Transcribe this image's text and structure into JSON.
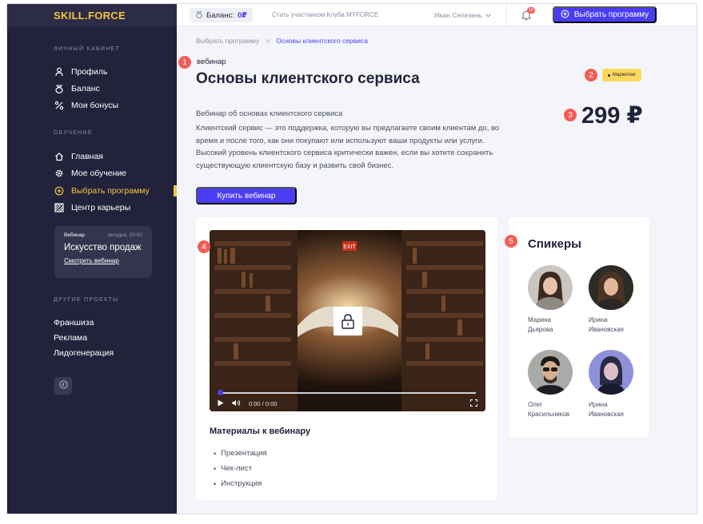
{
  "app": {
    "logo": "SKILL.FORCE"
  },
  "header": {
    "balance_label": "Баланс:",
    "balance_value": "0₽",
    "club_link": "Стать участником Клуба MYFORCE",
    "user_name": "Иван Селезень",
    "notifications_count": "10",
    "choose_program": "Выбрать программу"
  },
  "sidebar": {
    "section_personal": "ЛИЧНЫЙ КАБИНЕТ",
    "personal_items": [
      {
        "label": "Профиль",
        "icon": "profile-icon"
      },
      {
        "label": "Баланс",
        "icon": "wallet-icon"
      },
      {
        "label": "Мои бонусы",
        "icon": "percent-icon"
      }
    ],
    "section_learning": "ОБУЧЕНИЕ",
    "learning_items": [
      {
        "label": "Главная",
        "icon": "home-icon"
      },
      {
        "label": "Мое обучение",
        "icon": "gear-icon"
      },
      {
        "label": "Выбрать программу",
        "icon": "plus-circle-icon",
        "active": true
      },
      {
        "label": "Центр карьеры",
        "icon": "grid-icon"
      }
    ],
    "webinar_card": {
      "badge": "Вебинар",
      "date": "сегодня, 20:00",
      "title": "Искусство продаж",
      "link": "Смотреть вебинар"
    },
    "section_other": "ДРУГИЕ ПРОЕКТЫ",
    "other_items": [
      "Франшиза",
      "Реклама",
      "Лидогенерация"
    ]
  },
  "breadcrumb": {
    "items": [
      "Выбрать программу",
      "Основы клиентского сервиса"
    ],
    "separator": ">"
  },
  "product": {
    "type": "вебинар",
    "title": "Основы клиентского сервиса",
    "tag": "Маркетинг",
    "price": "299 ₽",
    "desc_title": "Вебинар об основах клиентского сервиса",
    "description": "Клиентский сервис — это поддержка, которую вы предлагаете своим клиентам до, во время и после того, как они покупают или используют ваши продукты или услуги. Высокий уровень клиентского сервиса критически важен, если вы хотите сохранить существующую клиентскую базу и развить свой бизнес.",
    "buy_button": "Купить вебинар"
  },
  "video": {
    "time": "0:00 / 0:00",
    "progress": 0
  },
  "materials": {
    "title": "Материалы к вебинару",
    "items": [
      "Презентация",
      "Чек-лист",
      "Инструкция"
    ]
  },
  "speakers": {
    "title": "Спикеры",
    "items": [
      {
        "first": "Марина",
        "last": "Дьярова"
      },
      {
        "first": "Ирина",
        "last": "Ивановская"
      },
      {
        "first": "Олег",
        "last": "Красильников"
      },
      {
        "first": "Ирина",
        "last": "Ивановская"
      }
    ]
  },
  "annotations": [
    "1",
    "2",
    "3",
    "4",
    "5"
  ],
  "colors": {
    "accent": "#4b3df5",
    "sidebar": "#22223b",
    "highlight": "#f3c63f",
    "annotation": "#f25c54"
  }
}
